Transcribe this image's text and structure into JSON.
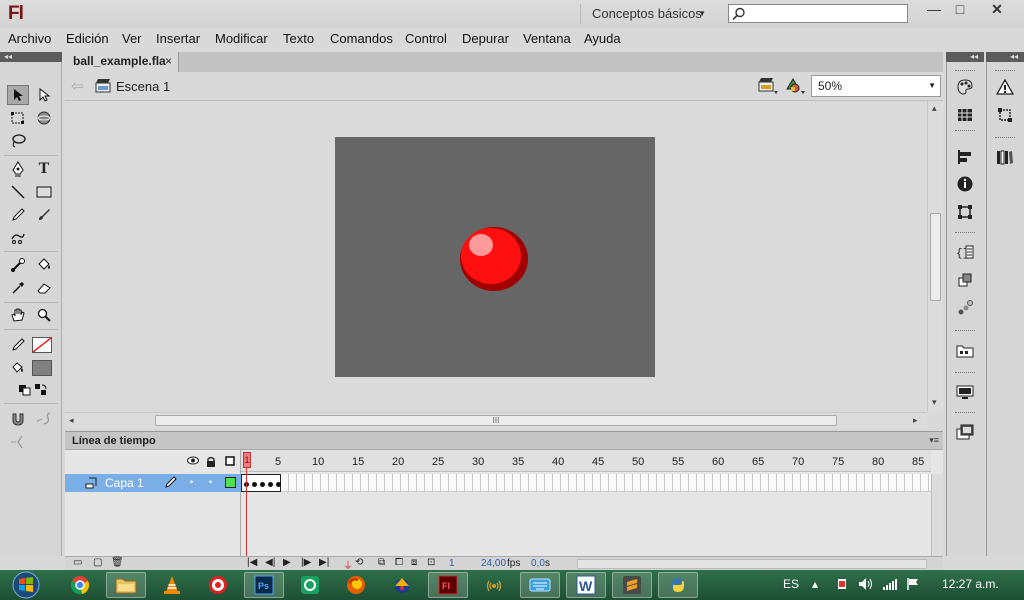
{
  "app": {
    "logo": "Fl",
    "workspace": "Conceptos básicos",
    "search_placeholder": "",
    "window_buttons": {
      "minimize": "—",
      "maximize": "□",
      "close": "✕"
    }
  },
  "menu": [
    "Archivo",
    "Edición",
    "Ver",
    "Insertar",
    "Modificar",
    "Texto",
    "Comandos",
    "Control",
    "Depurar",
    "Ventana",
    "Ayuda"
  ],
  "collapse_glyph": "◂◂",
  "document": {
    "tab_label": "ball_example.fla",
    "tab_close": "×",
    "scene_label": "Escena 1",
    "zoom": "50%",
    "stage_color": "#666666",
    "ball_color": "#ff0000"
  },
  "scroll_grip": "III",
  "timeline": {
    "title": "Línea de tiempo",
    "layer_name": "Capa 1",
    "frame_numbers": [
      "1",
      "5",
      "10",
      "15",
      "20",
      "25",
      "30",
      "35",
      "40",
      "45",
      "50",
      "55",
      "60",
      "65",
      "70",
      "75",
      "80",
      "85"
    ],
    "current_frame": "1",
    "fps": "24,00",
    "fps_unit": "fps",
    "time": "0,0",
    "time_unit": "s",
    "keyframe_count": 5
  },
  "taskbar": {
    "language": "ES",
    "clock": "12:27 a.m.",
    "apps": [
      "chrome-icon",
      "explorer-icon",
      "vlc-icon",
      "target-icon",
      "photoshop-icon",
      "app-icon",
      "firefox-icon",
      "app-icon-2",
      "flash-icon",
      "network-icon",
      "keyboard-icon",
      "word-icon",
      "sublime-icon",
      "python-icon"
    ]
  }
}
